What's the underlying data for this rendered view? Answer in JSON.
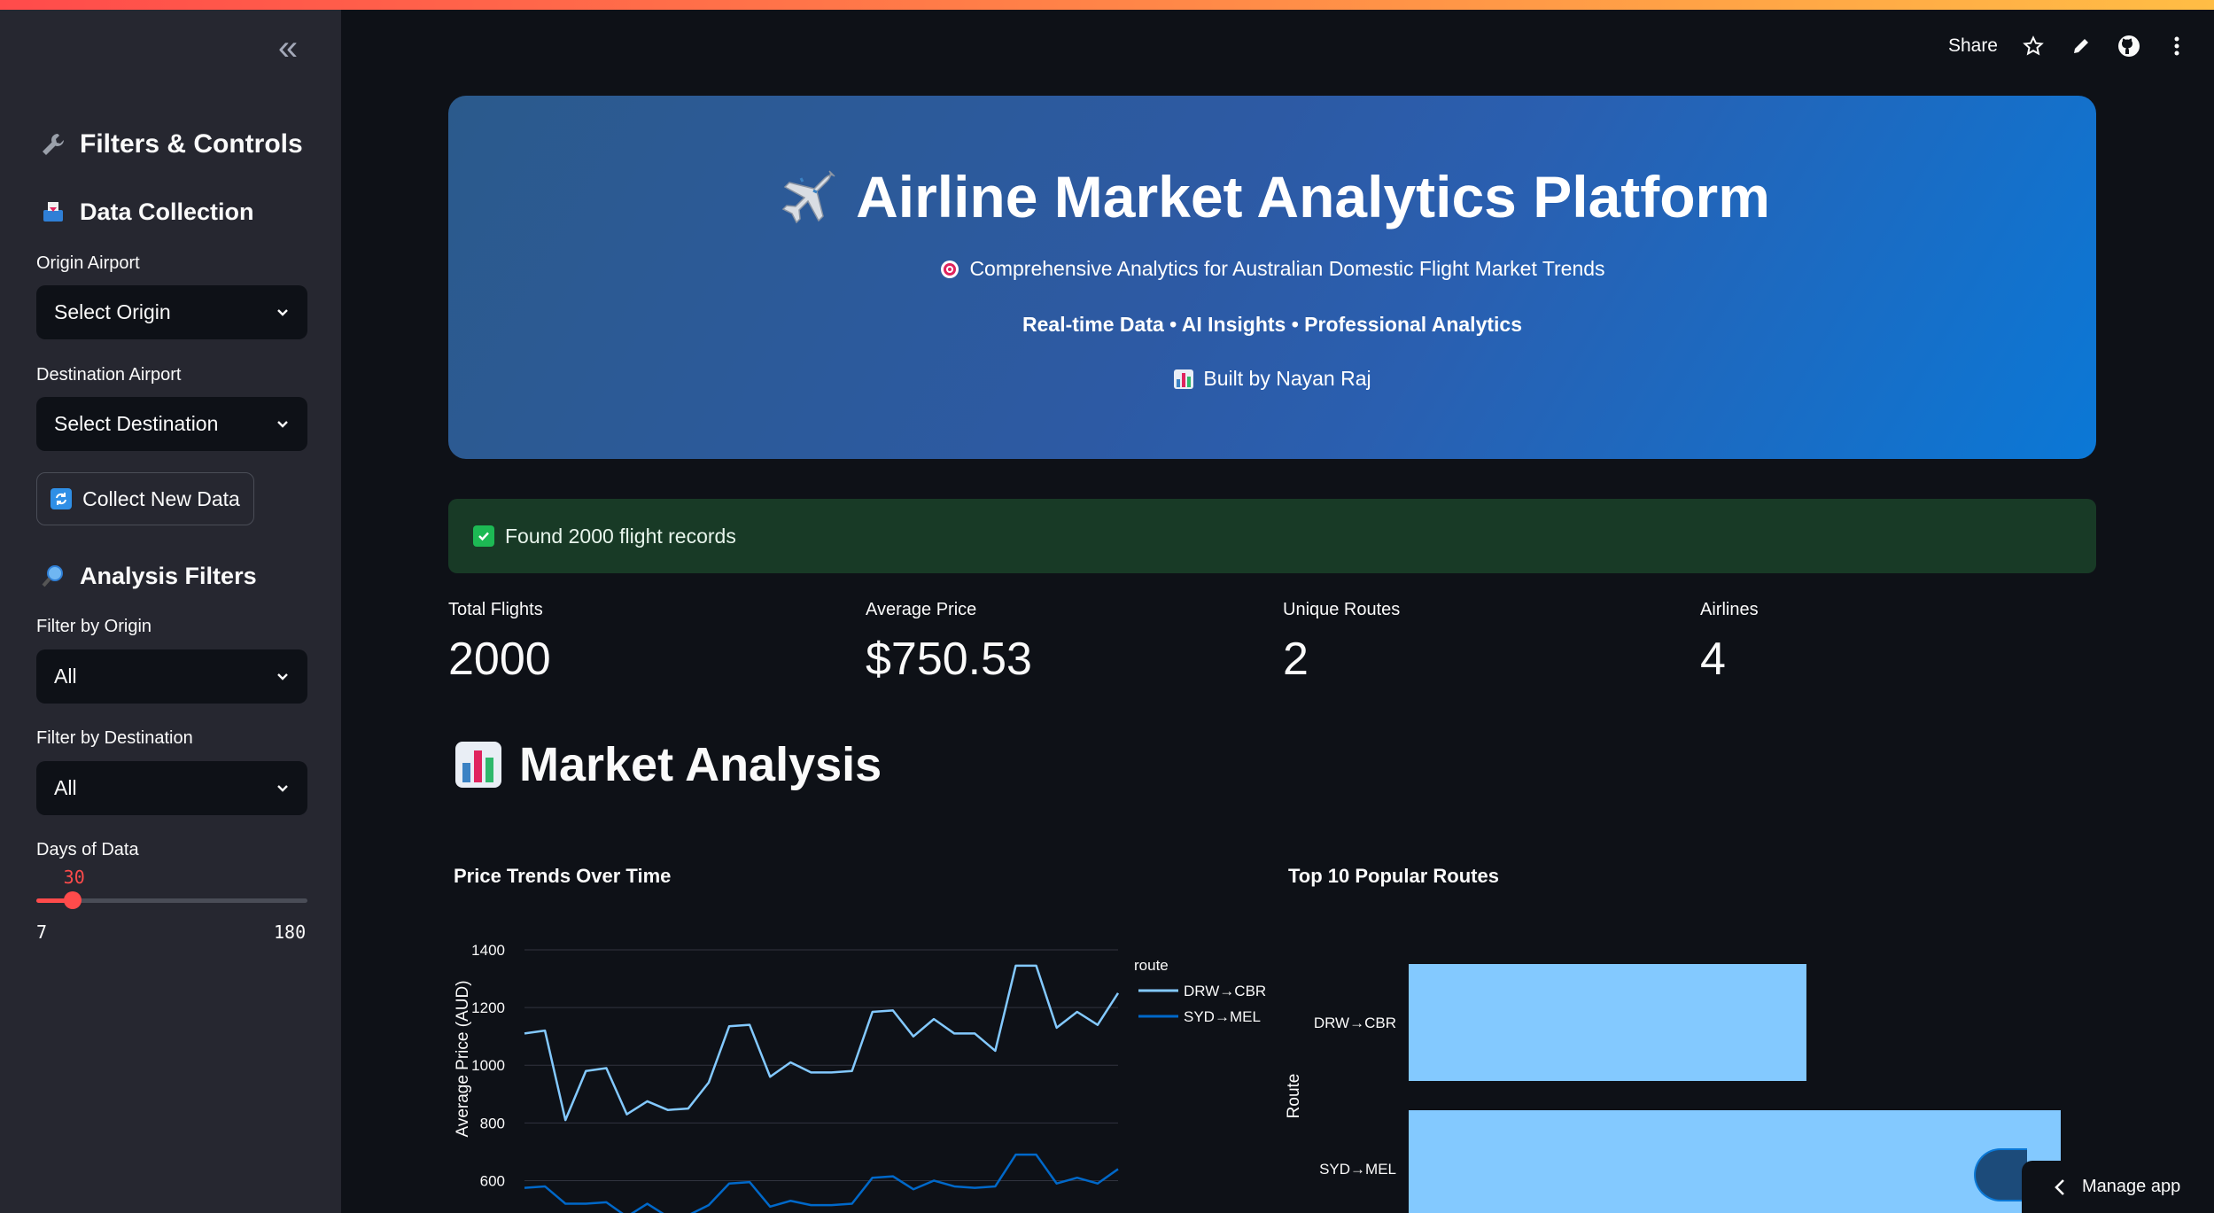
{
  "toolbar": {
    "share": "Share",
    "icons": [
      "star-icon",
      "pencil-icon",
      "github-icon",
      "more-icon"
    ]
  },
  "sidebar": {
    "heading": "Filters & Controls",
    "data_collection": {
      "heading": "Data Collection",
      "origin_label": "Origin Airport",
      "origin_value": "Select Origin",
      "destination_label": "Destination Airport",
      "destination_value": "Select Destination",
      "collect_button": "Collect New Data"
    },
    "analysis_filters": {
      "heading": "Analysis Filters",
      "origin_label": "Filter by Origin",
      "origin_value": "All",
      "destination_label": "Filter by Destination",
      "destination_value": "All",
      "days_label": "Days of Data",
      "days_value": "30",
      "days_min": "7",
      "days_max": "180"
    }
  },
  "hero": {
    "title": "Airline Market Analytics Platform",
    "subtitle": "Comprehensive Analytics for Australian Domestic Flight Market Trends",
    "tagline": "Real-time Data • AI Insights • Professional Analytics",
    "byline": "Built by Nayan Raj"
  },
  "alert": {
    "text": "Found 2000 flight records"
  },
  "metrics": [
    {
      "label": "Total Flights",
      "value": "2000"
    },
    {
      "label": "Average Price",
      "value": "$750.53"
    },
    {
      "label": "Unique Routes",
      "value": "2"
    },
    {
      "label": "Airlines",
      "value": "4"
    }
  ],
  "section": {
    "title": "Market Analysis"
  },
  "chart_data": [
    {
      "type": "line",
      "title": "Price Trends Over Time",
      "xlabel": "",
      "ylabel": "Average Price (AUD)",
      "yticks": [
        "1400",
        "1200",
        "1000",
        "800",
        "600"
      ],
      "ylim": [
        540,
        1400
      ],
      "legend_title": "route",
      "legend": "top-right",
      "series": [
        {
          "name": "DRW→CBR",
          "color": "#83c9ff",
          "values": [
            1110,
            1120,
            810,
            980,
            990,
            830,
            875,
            845,
            850,
            940,
            1135,
            1140,
            960,
            1010,
            975,
            975,
            980,
            1185,
            1190,
            1100,
            1160,
            1110,
            1110,
            1050,
            1345,
            1345,
            1130,
            1185,
            1140,
            1250
          ]
        },
        {
          "name": "SYD→MEL",
          "color": "#0068c9",
          "values": [
            575,
            580,
            520,
            520,
            525,
            475,
            520,
            475,
            480,
            515,
            590,
            595,
            510,
            530,
            515,
            515,
            520,
            610,
            615,
            570,
            600,
            580,
            575,
            580,
            690,
            690,
            590,
            610,
            590,
            640
          ]
        }
      ]
    },
    {
      "type": "bar",
      "orientation": "horizontal",
      "title": "Top 10 Popular Routes",
      "xlabel": "",
      "ylabel": "Route",
      "categories": [
        "DRW→CBR",
        "SYD→MEL"
      ],
      "values": [
        0.61,
        1.0
      ],
      "color": "#83c9ff"
    }
  ],
  "manage": {
    "label": "Manage app"
  }
}
